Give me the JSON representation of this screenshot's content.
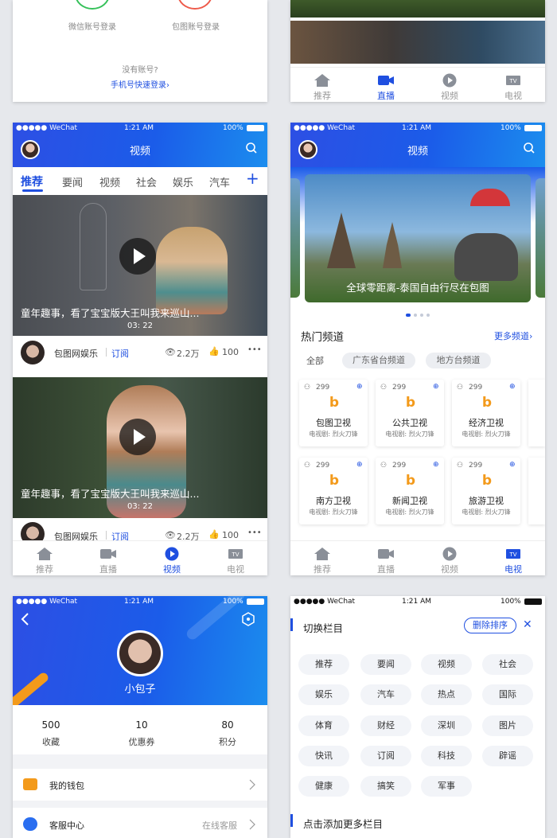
{
  "login": {
    "wechat_label": "微信账号登录",
    "baotu_label": "包图账号登录",
    "no_account": "没有账号?",
    "phone_login": "手机号快速登录›"
  },
  "status": {
    "carrier": "●●●●● WeChat",
    "time": "1:21 AM",
    "battery": "100%"
  },
  "tabs": {
    "rec": "推荐",
    "live": "直播",
    "video": "视频",
    "tv": "电视",
    "tv_badge": "TV"
  },
  "video_page": {
    "title": "视频",
    "categories": [
      "推荐",
      "要闻",
      "视频",
      "社会",
      "娱乐",
      "汽车"
    ],
    "add": "+",
    "videos": [
      {
        "title": "童年趣事，看了宝宝版大王叫我来巡山...",
        "duration": "03: 22",
        "author": "包图网娱乐",
        "subscribe": "订阅",
        "views": "2.2万",
        "likes": "100",
        "more": "•••"
      },
      {
        "title": "童年趣事，看了宝宝版大王叫我来巡山...",
        "duration": "03: 22",
        "author": "包图网娱乐",
        "subscribe": "订阅",
        "views": "2.2万",
        "likes": "100",
        "more": "•••"
      }
    ]
  },
  "channel_page": {
    "title": "视频",
    "banner_caption": "全球零距离-泰国自由行尽在包图",
    "hot_title": "热门频道",
    "more_link": "更多频道›",
    "filters": [
      "全部",
      "广东省台频道",
      "地方台频道"
    ],
    "cards": [
      {
        "count": "299",
        "name": "包图卫视",
        "sub": "电视剧: 烈火刀锋"
      },
      {
        "count": "299",
        "name": "公共卫视",
        "sub": "电视剧: 烈火刀锋"
      },
      {
        "count": "299",
        "name": "经济卫视",
        "sub": "电视剧: 烈火刀锋"
      },
      {
        "count": "299",
        "name": "南方卫视",
        "sub": "电视剧: 烈火刀锋"
      },
      {
        "count": "299",
        "name": "新闻卫视",
        "sub": "电视剧: 烈火刀锋"
      },
      {
        "count": "299",
        "name": "旅游卫视",
        "sub": "电视剧: 烈火刀锋"
      }
    ],
    "card_logo": "b"
  },
  "profile_page": {
    "username": "小包子",
    "stats": [
      {
        "value": "500",
        "label": "收藏"
      },
      {
        "value": "10",
        "label": "优惠券"
      },
      {
        "value": "80",
        "label": "积分"
      }
    ],
    "menu": [
      {
        "label": "我的钱包",
        "extra": ""
      },
      {
        "label": "客服中心",
        "extra": "在线客服"
      }
    ]
  },
  "column_page": {
    "switch_title": "切换栏目",
    "delete_sort": "删除排序",
    "close": "✕",
    "items": [
      "推荐",
      "要闻",
      "视频",
      "社会",
      "娱乐",
      "汽车",
      "热点",
      "国际",
      "体育",
      "财经",
      "深圳",
      "图片",
      "快讯",
      "订阅",
      "科技",
      "辟谣",
      "健康",
      "搞笑",
      "军事"
    ],
    "add_more": "点击添加更多栏目"
  },
  "colors": {
    "accent": "#1f4fe0",
    "orange": "#f39a1b"
  }
}
